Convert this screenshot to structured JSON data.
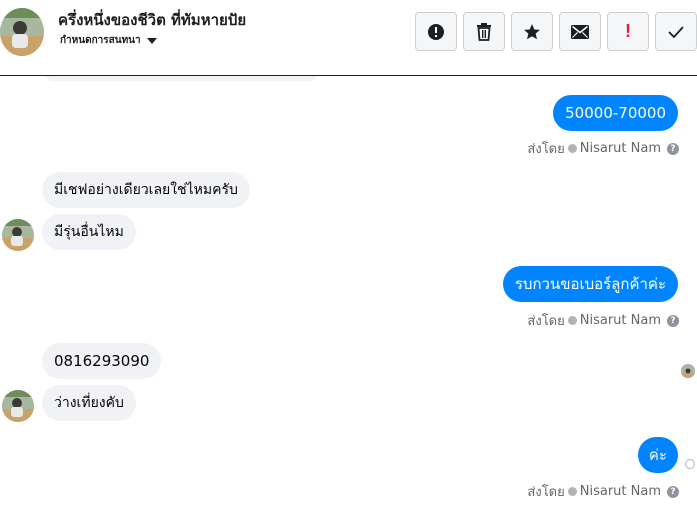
{
  "header": {
    "contact_name": "ครึ่งหนึ่งของชีวิต ที่ทัมหายปัย",
    "assign_label": "กำหนดการสนทนา",
    "actions": [
      {
        "name": "report-spam",
        "icon": "exclamation-circle-icon"
      },
      {
        "name": "delete",
        "icon": "trash-icon"
      },
      {
        "name": "star",
        "icon": "star-icon"
      },
      {
        "name": "mark-unread",
        "icon": "envelope-icon"
      },
      {
        "name": "mark-important",
        "icon": "exclamation-icon",
        "label": "!"
      },
      {
        "name": "mark-done",
        "icon": "check-icon"
      }
    ]
  },
  "messages": [
    {
      "from": "page",
      "text": "50000-70000"
    },
    {
      "from": "customer",
      "text": "มีเชฟอย่างเดียวเลยใช่ไหมครับ"
    },
    {
      "from": "customer",
      "text": "มีรุ่นอื่นไหม"
    },
    {
      "from": "page",
      "text": "รบกวนขอเบอร์ลูกค้าค่ะ"
    },
    {
      "from": "customer",
      "text": "0816293090"
    },
    {
      "from": "customer",
      "text": "ว่างเที่ยงคับ"
    },
    {
      "from": "page",
      "text": "ค่ะ"
    }
  ],
  "sent_by": {
    "prefix": "ส่งโดย",
    "agent": "Nisarut Nam",
    "help": "?"
  },
  "colors": {
    "outgoing_bubble": "#0084ff",
    "incoming_bubble": "#f0f2f5",
    "meta_text": "#65676b"
  }
}
